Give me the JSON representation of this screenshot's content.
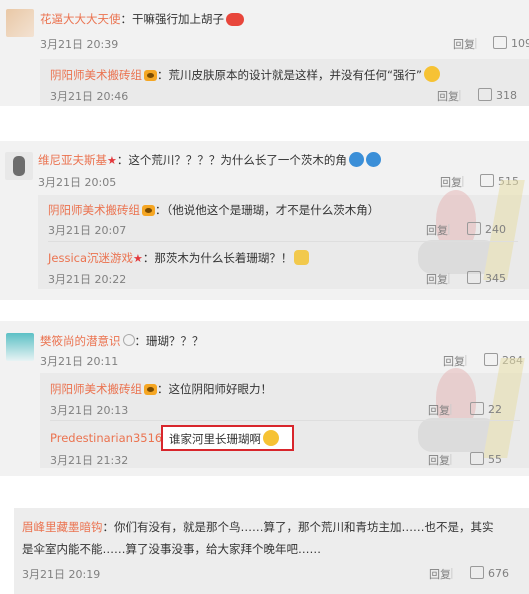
{
  "c1": {
    "user": "花逼大大大天使",
    "text": "：干嘛强行加上胡子",
    "time": "3月21日 20:39",
    "reply": "回复",
    "likes": "109",
    "sub": {
      "user": "阴阳师美术搬砖组",
      "text": "：荒川皮肤原本的设计就是这样，并没有任何“强行”",
      "time": "3月21日 20:46",
      "reply": "回复",
      "likes": "318"
    }
  },
  "c2": {
    "user": "维尼亚夫斯基",
    "text": "：这个荒川？？？？为什么长了一个茨木的角",
    "time": "3月21日 20:05",
    "reply": "回复",
    "likes": "515",
    "subs": [
      {
        "user": "阴阳师美术搬砖组",
        "text": "：（他说他这个是珊瑚，才不是什么茨木角）",
        "time": "3月21日 20:07",
        "reply": "回复",
        "likes": "240"
      },
      {
        "user": "Jessica沉迷游戏",
        "text": "：那茨木为什么长着珊瑚？！",
        "time": "3月21日 20:22",
        "reply": "回复",
        "likes": "345"
      }
    ]
  },
  "c3": {
    "user": "樊筱尚的潜意识",
    "text": "：珊瑚？？？",
    "time": "3月21日 20:11",
    "reply": "回复",
    "likes": "284",
    "subs": [
      {
        "user": "阴阳师美术搬砖组",
        "text": "：这位阴阳师好眼力！",
        "time": "3月21日 20:13",
        "reply": "回复",
        "likes": "22"
      },
      {
        "user": "Predestinarian35168",
        "text": "谁家河里长珊瑚啊",
        "time": "3月21日 21:32",
        "reply": "回复",
        "likes": "55"
      }
    ]
  },
  "c4": {
    "user": "眉峰里藏墨暗钩",
    "line1": "：你们有没有，就是那个鸟……算了，那个荒川和青坊主加……也不是，其实",
    "line2": "是伞室内能不能……算了没事没事，给大家拜个晚年吧……",
    "time": "3月21日 20:19",
    "reply": "回复",
    "likes": "676"
  },
  "colors": {
    "username": "#eb7350",
    "highlight_box": "#d8252b",
    "card_bg": "#f2f2f2"
  },
  "icons": [
    "thumbs-up-icon",
    "reply-link",
    "vip-badge-icon",
    "star-icon",
    "emoji-icon"
  ]
}
